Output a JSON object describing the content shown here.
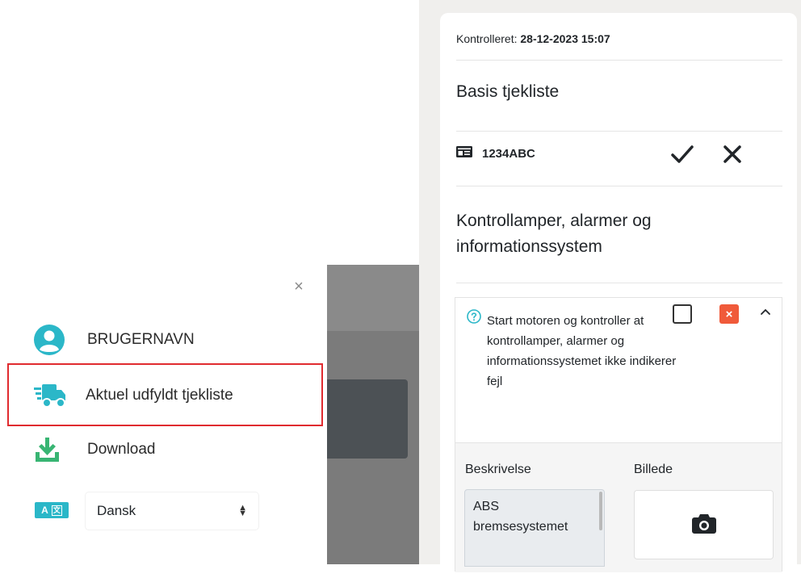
{
  "menu": {
    "close_symbol": "×",
    "username": "BRUGERNAVN",
    "current_checklist": "Aktuel udfyldt tjekliste",
    "download": "Download",
    "language_badge_left": "A",
    "language_badge_right": "文",
    "language_value": "Dansk",
    "active_border_color": "#e02b2f",
    "icon_color": "#2bb7c8",
    "download_icon_color": "#38b573"
  },
  "checklist": {
    "controlled_label": "Kontrolleret: ",
    "controlled_datetime": "28-12-2023 15:07",
    "basis_title": "Basis tjekliste",
    "plate": "1234ABC",
    "section_title": "Kontrollamper, alarmer og informationssystem",
    "question": "Start motoren og kontroller at kontrollamper, alarmer og informationssystemet ikke indikerer fejl",
    "fail_symbol": "×",
    "description_label": "Beskrivelse",
    "image_label": "Billede",
    "description_value": "ABS bremsesystemet",
    "fail_color": "#f05a3a"
  }
}
